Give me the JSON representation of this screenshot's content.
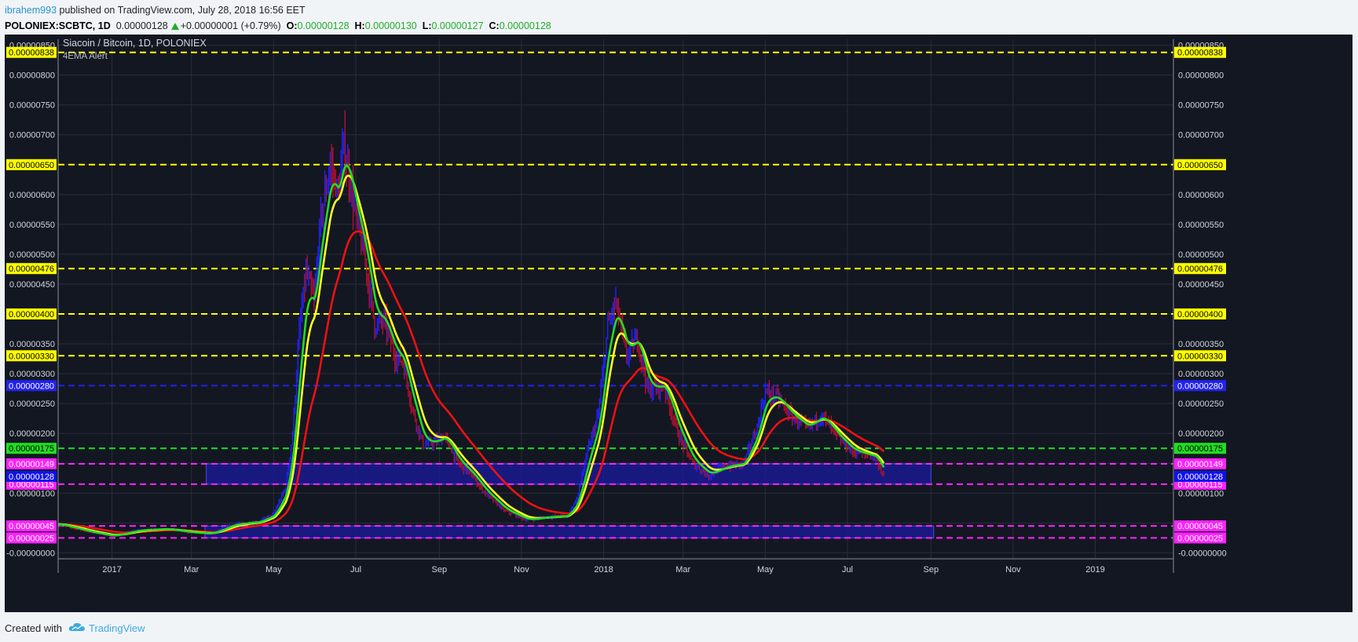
{
  "header": {
    "author": "ibrahem993",
    "published": " published on TradingView.com, July 28, 2018 16:56 EET",
    "symbol": "POLONIEX:SCBTC, 1D",
    "last": "0.00000128",
    "change": "+0.00000001 (+0.79%)",
    "o_label": "O:",
    "o": "0.00000128",
    "h_label": "H:",
    "h": "0.00000130",
    "l_label": "L:",
    "l": "0.00000127",
    "c_label": "C:",
    "c": "0.00000128"
  },
  "footer": {
    "created_with": "Created with",
    "brand": "TradingView"
  },
  "colors": {
    "background": "#131722",
    "up": "#2222ff",
    "down": "#b01030",
    "ema_fast": "#22dd22",
    "ema_mid": "#ffff22",
    "ema_slow": "#ee1111",
    "zone": "#1a1a9a"
  },
  "chart_data": {
    "type": "candlestick",
    "title": "Siacoin / Bitcoin, 1D, POLONIEX",
    "indicator": "4EMA Alert",
    "ylim": [
      -1e-07,
      8.6e-06
    ],
    "y_ticks": [
      "0.00000850",
      "0.00000800",
      "0.00000750",
      "0.00000700",
      "0.00000650",
      "0.00000600",
      "0.00000550",
      "0.00000500",
      "0.00000450",
      "0.00000400",
      "0.00000350",
      "0.00000300",
      "0.00000250",
      "0.00000200",
      "0.00000150",
      "0.00000100",
      "0.00000050",
      "-0.00000000"
    ],
    "x_ticks": [
      {
        "label": "2017",
        "date": "2017-01-01"
      },
      {
        "label": "Mar",
        "date": "2017-03-01"
      },
      {
        "label": "May",
        "date": "2017-05-01"
      },
      {
        "label": "Jul",
        "date": "2017-07-01"
      },
      {
        "label": "Sep",
        "date": "2017-09-01"
      },
      {
        "label": "Nov",
        "date": "2017-11-01"
      },
      {
        "label": "2018",
        "date": "2018-01-01"
      },
      {
        "label": "Mar",
        "date": "2018-03-01"
      },
      {
        "label": "May",
        "date": "2018-05-01"
      },
      {
        "label": "Jul",
        "date": "2018-07-01"
      },
      {
        "label": "Sep",
        "date": "2018-09-01"
      },
      {
        "label": "Nov",
        "date": "2018-11-01"
      },
      {
        "label": "2019",
        "date": "2019-01-01"
      }
    ],
    "x_range": [
      "2016-11-22",
      "2019-02-28"
    ],
    "horizontal_lines": [
      {
        "value": 8.38e-06,
        "label": "0.00000838",
        "color": "#ffff00",
        "label_color": "#000000"
      },
      {
        "value": 6.5e-06,
        "label": "0.00000650",
        "color": "#ffff00",
        "label_color": "#000000"
      },
      {
        "value": 4.76e-06,
        "label": "0.00000476",
        "color": "#ffff00",
        "label_color": "#000000"
      },
      {
        "value": 4e-06,
        "label": "0.00000400",
        "color": "#ffff00",
        "label_color": "#000000"
      },
      {
        "value": 3.3e-06,
        "label": "0.00000330",
        "color": "#ffff00",
        "label_color": "#000000"
      },
      {
        "value": 2.8e-06,
        "label": "0.00000280",
        "color": "#2222ee",
        "label_color": "#ffffff"
      },
      {
        "value": 1.75e-06,
        "label": "0.00000175",
        "color": "#22dd22",
        "label_color": "#000000"
      },
      {
        "value": 1.49e-06,
        "label": "0.00000149",
        "color": "#ff22ff",
        "label_color": "#ffffff"
      },
      {
        "value": 1.15e-06,
        "label": "0.00000115",
        "color": "#ff22ff",
        "label_color": "#ffffff"
      },
      {
        "value": 4.5e-07,
        "label": "0.00000045",
        "color": "#ff22ff",
        "label_color": "#ffffff"
      },
      {
        "value": 2.5e-07,
        "label": "0.00000025",
        "color": "#ff22ff",
        "label_color": "#ffffff"
      }
    ],
    "current_price": {
      "value": 1.28e-06,
      "label": "0.00000128",
      "color": "#1010ee"
    },
    "zones": [
      {
        "x_start": "2017-03-12",
        "x_end": "2018-09-01",
        "y_low": 1.15e-06,
        "y_high": 1.49e-06
      },
      {
        "x_start": "2017-03-11",
        "x_end": "2018-09-03",
        "y_low": 2.5e-07,
        "y_high": 4.5e-07
      }
    ],
    "price_path": [
      [
        "2016-11-22",
        4.8e-07
      ],
      [
        "2016-12-15",
        3.5e-07
      ],
      [
        "2017-01-01",
        2.8e-07
      ],
      [
        "2017-01-20",
        3.8e-07
      ],
      [
        "2017-02-10",
        4e-07
      ],
      [
        "2017-03-01",
        3.4e-07
      ],
      [
        "2017-03-15",
        3.2e-07
      ],
      [
        "2017-04-01",
        4.8e-07
      ],
      [
        "2017-04-20",
        5.2e-07
      ],
      [
        "2017-05-01",
        6.5e-07
      ],
      [
        "2017-05-10",
        1.1e-06
      ],
      [
        "2017-05-15",
        2e-06
      ],
      [
        "2017-05-20",
        3.7e-06
      ],
      [
        "2017-05-25",
        4.7e-06
      ],
      [
        "2017-05-31",
        4.2e-06
      ],
      [
        "2017-06-05",
        5.6e-06
      ],
      [
        "2017-06-12",
        6.5e-06
      ],
      [
        "2017-06-18",
        6e-06
      ],
      [
        "2017-06-22",
        6.8e-06
      ],
      [
        "2017-06-27",
        6.2e-06
      ],
      [
        "2017-07-01",
        5.6e-06
      ],
      [
        "2017-07-08",
        4.9e-06
      ],
      [
        "2017-07-15",
        3.8e-06
      ],
      [
        "2017-07-22",
        3.9e-06
      ],
      [
        "2017-07-30",
        3.3e-06
      ],
      [
        "2017-08-05",
        3.2e-06
      ],
      [
        "2017-08-12",
        2.4e-06
      ],
      [
        "2017-08-20",
        1.8e-06
      ],
      [
        "2017-08-28",
        1.85e-06
      ],
      [
        "2017-09-05",
        1.95e-06
      ],
      [
        "2017-09-15",
        1.5e-06
      ],
      [
        "2017-09-25",
        1.3e-06
      ],
      [
        "2017-10-05",
        1e-06
      ],
      [
        "2017-10-20",
        7e-07
      ],
      [
        "2017-11-05",
        5.5e-07
      ],
      [
        "2017-11-20",
        6e-07
      ],
      [
        "2017-12-05",
        6.2e-07
      ],
      [
        "2017-12-12",
        9e-07
      ],
      [
        "2017-12-20",
        1.7e-06
      ],
      [
        "2017-12-28",
        2.3e-06
      ],
      [
        "2018-01-04",
        3.8e-06
      ],
      [
        "2018-01-10",
        4.2e-06
      ],
      [
        "2018-01-18",
        3.3e-06
      ],
      [
        "2018-01-26",
        3.6e-06
      ],
      [
        "2018-02-03",
        2.7e-06
      ],
      [
        "2018-02-15",
        2.8e-06
      ],
      [
        "2018-02-25",
        2e-06
      ],
      [
        "2018-03-08",
        1.5e-06
      ],
      [
        "2018-03-20",
        1.3e-06
      ],
      [
        "2018-04-01",
        1.45e-06
      ],
      [
        "2018-04-15",
        1.5e-06
      ],
      [
        "2018-04-25",
        2.1e-06
      ],
      [
        "2018-05-01",
        2.7e-06
      ],
      [
        "2018-05-10",
        2.6e-06
      ],
      [
        "2018-05-20",
        2.3e-06
      ],
      [
        "2018-06-01",
        2.1e-06
      ],
      [
        "2018-06-12",
        2.3e-06
      ],
      [
        "2018-06-25",
        1.9e-06
      ],
      [
        "2018-07-05",
        1.7e-06
      ],
      [
        "2018-07-15",
        1.65e-06
      ],
      [
        "2018-07-22",
        1.6e-06
      ],
      [
        "2018-07-28",
        1.28e-06
      ]
    ]
  }
}
